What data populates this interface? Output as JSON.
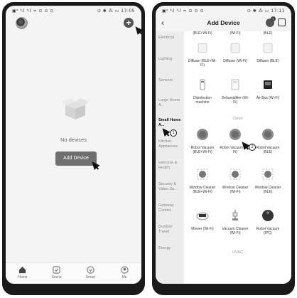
{
  "left": {
    "statusbar": {
      "left": "▣ᵃ ⁴ᵢl ⁴ᵢl ≈ ⊙ ⊙ ⊙",
      "right": "⊙ ✱ ⁂ ▭ 17:05"
    },
    "empty_text": "No devices",
    "add_device_label": "Add Device",
    "tabs": [
      "Home",
      "Scene",
      "Smart",
      "Me"
    ]
  },
  "right": {
    "statusbar": {
      "left": "▣ᵃ ⁴ᵢl ⁴ᵢl ≈ ⊙ ⊙ ⊙",
      "right": "⊙ ✱ ⁂ ▭ 17:11"
    },
    "title": "Add Device",
    "back": "‹",
    "badge_count": "1",
    "categories": [
      "Electrical",
      "Lighting",
      "Sensors",
      "Large Home A...",
      "Small Home A...",
      "Kitchen Appliances",
      "Exercise & Health",
      "Security & Video Su...",
      "Gateway Control",
      "Outdoor Travel",
      "Energy"
    ],
    "top_partial": [
      "(BLE+Wi-Fi)",
      "(Wi-Fi)",
      "(BLE)"
    ],
    "sections": {
      "clean": "Clean",
      "hvac": "HVAC"
    },
    "devices": [
      [
        "Diffuser (BLE+Wi-Fi)",
        "Diffuser (Wi-Fi)",
        "Diffuser (BLE)"
      ],
      [
        "Disinfection machine",
        "Dehumidifier (Wi-Fi)",
        "Air Box (Wi-Fi)"
      ],
      [
        "Robot Vacuum (BLE+Wi-Fi)",
        "Robot Vacuum (Wi-Fi)",
        "Robot Vacuum (BLE)"
      ],
      [
        "Window Cleaner (BLE+Wi-Fi)",
        "Window Cleaner (Wi-Fi)",
        "Window Cleaner (BLE)"
      ],
      [
        "Mower (Wi-Fi)",
        "Vacuum Cleaner (Wi-Fi)",
        "Robot Vacuum (IPC)"
      ]
    ],
    "step_markers": [
      "1",
      "2"
    ]
  }
}
